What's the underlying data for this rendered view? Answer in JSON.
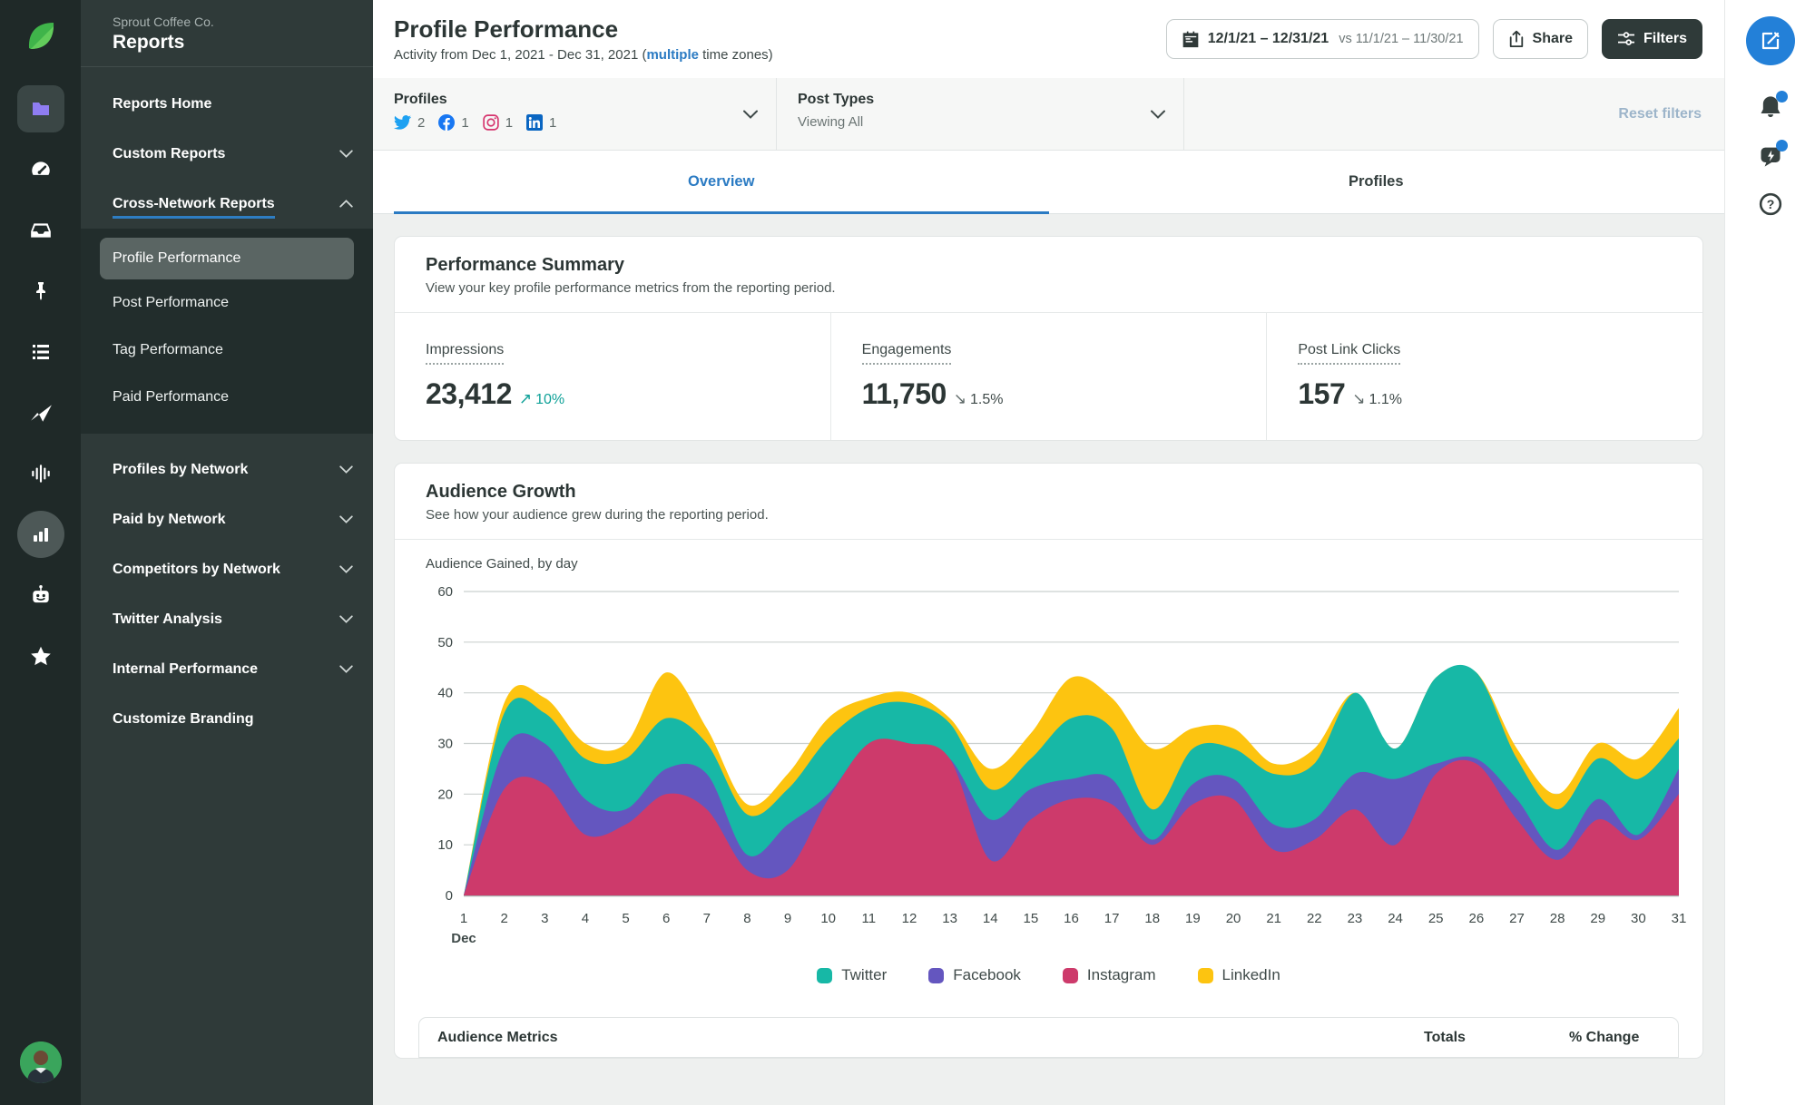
{
  "rail": {
    "icons": [
      {
        "name": "folder-icon",
        "active": true
      },
      {
        "name": "dashboard-icon"
      },
      {
        "name": "inbox-icon"
      },
      {
        "name": "pin-icon"
      },
      {
        "name": "list-icon"
      },
      {
        "name": "publish-plane-icon"
      },
      {
        "name": "listening-waveform-icon"
      },
      {
        "name": "reports-bars-icon",
        "active_circle": true
      },
      {
        "name": "bot-icon"
      },
      {
        "name": "star-icon"
      }
    ]
  },
  "sidebar": {
    "org": "Sprout Coffee Co.",
    "title": "Reports",
    "top_items": [
      {
        "label": "Reports Home",
        "chevron": "none"
      },
      {
        "label": "Custom Reports",
        "chevron": "down"
      },
      {
        "label": "Cross-Network Reports",
        "chevron": "up",
        "active_section": true
      }
    ],
    "submenu": [
      {
        "label": "Profile Performance",
        "current": true
      },
      {
        "label": "Post Performance"
      },
      {
        "label": "Tag Performance"
      },
      {
        "label": "Paid Performance"
      }
    ],
    "bottom_items": [
      {
        "label": "Profiles by Network",
        "chevron": "down"
      },
      {
        "label": "Paid by Network",
        "chevron": "down"
      },
      {
        "label": "Competitors by Network",
        "chevron": "down"
      },
      {
        "label": "Twitter Analysis",
        "chevron": "down"
      },
      {
        "label": "Internal Performance",
        "chevron": "down"
      },
      {
        "label": "Customize Branding",
        "chevron": "none"
      }
    ]
  },
  "header": {
    "title": "Profile Performance",
    "subtitle_prefix": "Activity from Dec 1, 2021 - Dec 31, 2021 (",
    "subtitle_link": "multiple",
    "subtitle_suffix": " time zones)",
    "date_range": "12/1/21 – 12/31/21",
    "date_compare": "vs 11/1/21 – 11/30/21",
    "share_label": "Share",
    "filters_label": "Filters"
  },
  "filter_bar": {
    "profiles_label": "Profiles",
    "profile_networks": [
      {
        "network": "twitter",
        "count": "2",
        "color": "#1da1f2"
      },
      {
        "network": "facebook",
        "count": "1",
        "color": "#1877f2"
      },
      {
        "network": "instagram",
        "count": "1",
        "color": "#d6356e"
      },
      {
        "network": "linkedin",
        "count": "1",
        "color": "#0a66c2"
      }
    ],
    "post_types_label": "Post Types",
    "post_types_value": "Viewing All",
    "reset_label": "Reset filters"
  },
  "tabs": [
    {
      "label": "Overview",
      "active": true
    },
    {
      "label": "Profiles",
      "active": false
    }
  ],
  "performance_summary": {
    "title": "Performance Summary",
    "subtitle": "View your key profile performance metrics from the reporting period.",
    "metrics": [
      {
        "label": "Impressions",
        "value": "23,412",
        "trend": "up",
        "change": "10%"
      },
      {
        "label": "Engagements",
        "value": "11,750",
        "trend": "down",
        "change": "1.5%"
      },
      {
        "label": "Post Link Clicks",
        "value": "157",
        "trend": "down",
        "change": "1.1%"
      }
    ]
  },
  "audience_growth": {
    "title": "Audience Growth",
    "subtitle": "See how your audience grew during the reporting period.",
    "table_header": {
      "metrics": "Audience Metrics",
      "totals": "Totals",
      "change": "% Change"
    }
  },
  "chart_data": {
    "type": "area",
    "stacked": true,
    "title": "Audience Gained, by day",
    "x": [
      1,
      2,
      3,
      4,
      5,
      6,
      7,
      8,
      9,
      10,
      11,
      12,
      13,
      14,
      15,
      16,
      17,
      18,
      19,
      20,
      21,
      22,
      23,
      24,
      25,
      26,
      27,
      28,
      29,
      30,
      31
    ],
    "x_month_label": "Dec",
    "yticks": [
      0,
      10,
      20,
      30,
      40,
      50,
      60
    ],
    "ylim": [
      0,
      60
    ],
    "grid": true,
    "legend_position": "bottom",
    "series_stack_order_bottom_to_top": [
      "Instagram",
      "Facebook",
      "Twitter",
      "LinkedIn"
    ],
    "series": [
      {
        "name": "Instagram",
        "color": "#cd3a6b",
        "values": [
          0,
          21,
          22,
          12,
          14,
          20,
          17,
          5,
          5,
          19,
          30,
          30,
          27,
          7,
          15,
          19,
          18,
          10,
          18,
          19,
          9,
          11,
          17,
          10,
          24,
          26,
          15,
          7,
          15,
          11,
          20
        ]
      },
      {
        "name": "Facebook",
        "color": "#6456bf",
        "values": [
          0,
          8,
          8,
          7,
          3,
          5,
          7,
          3,
          9,
          1,
          0,
          0,
          0,
          8,
          6,
          4,
          5,
          1,
          4,
          4,
          5,
          4,
          7,
          13,
          2,
          1,
          4,
          2,
          4,
          1,
          5
        ]
      },
      {
        "name": "Twitter",
        "color": "#17b8a6",
        "values": [
          0,
          7,
          6,
          8,
          10,
          10,
          6,
          8,
          7,
          11,
          7,
          8,
          7,
          6,
          6,
          12,
          10,
          6,
          7,
          6,
          10,
          11,
          16,
          6,
          17,
          17,
          8,
          8,
          8,
          11,
          6
        ]
      },
      {
        "name": "LinkedIn",
        "color": "#fdc410",
        "values": [
          0,
          2,
          3,
          3,
          3,
          9,
          3,
          2,
          3,
          4,
          2,
          2,
          1,
          4,
          5,
          8,
          6,
          12,
          4,
          4,
          2,
          3,
          0,
          0,
          0,
          0,
          2,
          3,
          3,
          4,
          6
        ]
      }
    ],
    "legend": [
      {
        "name": "Twitter",
        "color": "#17b8a6"
      },
      {
        "name": "Facebook",
        "color": "#6456bf"
      },
      {
        "name": "Instagram",
        "color": "#cd3a6b"
      },
      {
        "name": "LinkedIn",
        "color": "#fdc410"
      }
    ]
  },
  "right_rail": {
    "icons": [
      {
        "name": "compose-icon",
        "style": "primary-circle"
      },
      {
        "name": "notifications-bell-icon",
        "badge": true
      },
      {
        "name": "whats-new-icon",
        "badge": true
      },
      {
        "name": "help-icon"
      }
    ]
  }
}
